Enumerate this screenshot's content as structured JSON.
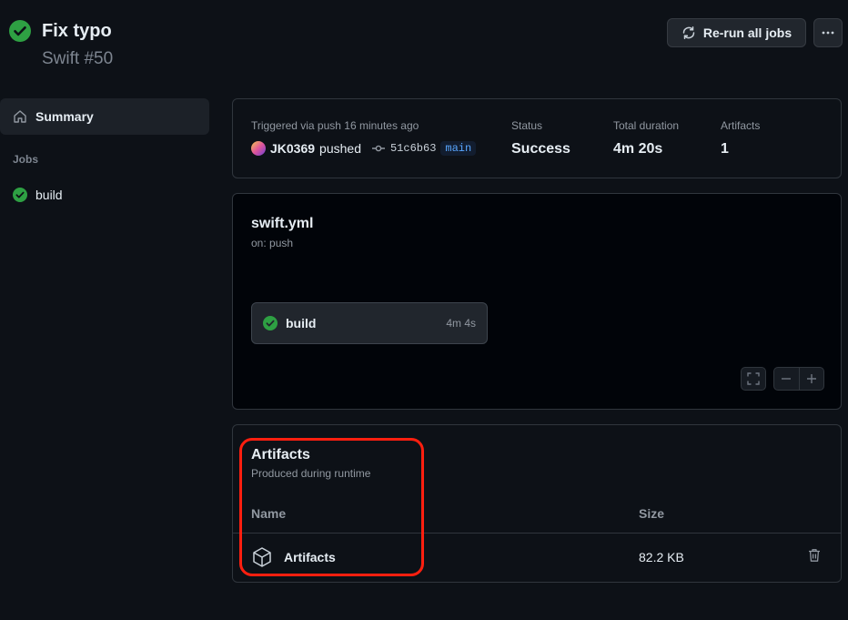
{
  "header": {
    "title": "Fix typo",
    "subtitle": "Swift #50",
    "rerun_label": "Re-run all jobs"
  },
  "sidebar": {
    "summary_label": "Summary",
    "jobs_heading": "Jobs",
    "jobs": [
      {
        "label": "build"
      }
    ]
  },
  "info": {
    "trigger_label": "Triggered via push 16 minutes ago",
    "actor": "JK0369",
    "action": "pushed",
    "commit": "51c6b63",
    "branch": "main",
    "status_label": "Status",
    "status_value": "Success",
    "duration_label": "Total duration",
    "duration_value": "4m 20s",
    "artifacts_label": "Artifacts",
    "artifacts_count": "1"
  },
  "workflow": {
    "file": "swift.yml",
    "trigger": "on: push",
    "job_name": "build",
    "job_duration": "4m 4s"
  },
  "artifacts": {
    "title": "Artifacts",
    "description": "Produced during runtime",
    "col_name": "Name",
    "col_size": "Size",
    "rows": [
      {
        "name": "Artifacts",
        "size": "82.2 KB"
      }
    ]
  },
  "colors": {
    "background": "#0d1117",
    "success": "#2ea043",
    "highlight": "#ff1f0f",
    "branch": "#58a6ff"
  }
}
